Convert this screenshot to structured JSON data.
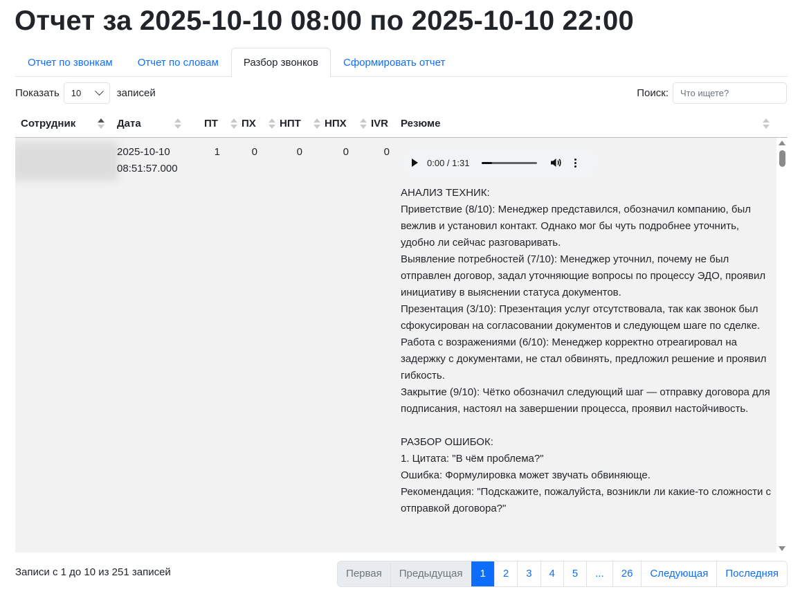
{
  "title": "Отчет за 2025-10-10 08:00 по 2025-10-10 22:00",
  "tabs": [
    {
      "label": "Отчет по звонкам"
    },
    {
      "label": "Отчет по словам"
    },
    {
      "label": "Разбор звонков",
      "active": true
    },
    {
      "label": "Сформировать отчет"
    }
  ],
  "length": {
    "prefix": "Показать",
    "value": "10",
    "suffix": "записей"
  },
  "search": {
    "label": "Поиск:",
    "placeholder": "Что ищете?"
  },
  "columns": [
    "Сотрудник",
    "Дата",
    "ПТ",
    "ПХ",
    "НПТ",
    "НПХ",
    "IVR",
    "Резюме"
  ],
  "row": {
    "date": "2025-10-10",
    "time": "08:51:57.000",
    "pt": "1",
    "ph": "0",
    "npt": "0",
    "nph": "0",
    "ivr": "0",
    "audio": {
      "time": "0:00 / 1:31",
      "progress": 0.18
    },
    "summary": "АНАЛИЗ ТЕХНИК:\nПриветствие (8/10): Менеджер представился, обозначил компанию, был вежлив и установил контакт. Однако мог бы чуть подробнее уточнить, удобно ли сейчас разговаривать.\nВыявление потребностей (7/10): Менеджер уточнил, почему не был отправлен договор, задал уточняющие вопросы по процессу ЭДО, проявил инициативу в выяснении статуса документов.\nПрезентация (3/10): Презентация услуг отсутствовала, так как звонок был сфокусирован на согласовании документов и следующем шаге по сделке.\nРабота с возражениями (6/10): Менеджер корректно отреагировал на задержку с документами, не стал обвинять, предложил решение и проявил гибкость.\nЗакрытие (9/10): Чётко обозначил следующий шаг — отправку договора для подписания, настоял на завершении процесса, проявил настойчивость.\n\nРАЗБОР ОШИБОК:\n1. Цитата: \"В чём проблема?\"\nОшибка: Формулировка может звучать обвиняюще.\nРекомендация: \"Подскажите, пожалуйста, возникли ли какие-то сложности с отправкой договора?\""
  },
  "info": "Записи с 1 до 10 из 251 записей",
  "pagination": {
    "first": "Первая",
    "prev": "Предыдущая",
    "pages": [
      "1",
      "2",
      "3",
      "4",
      "5",
      "...",
      "26"
    ],
    "next": "Следующая",
    "last": "Последняя"
  }
}
